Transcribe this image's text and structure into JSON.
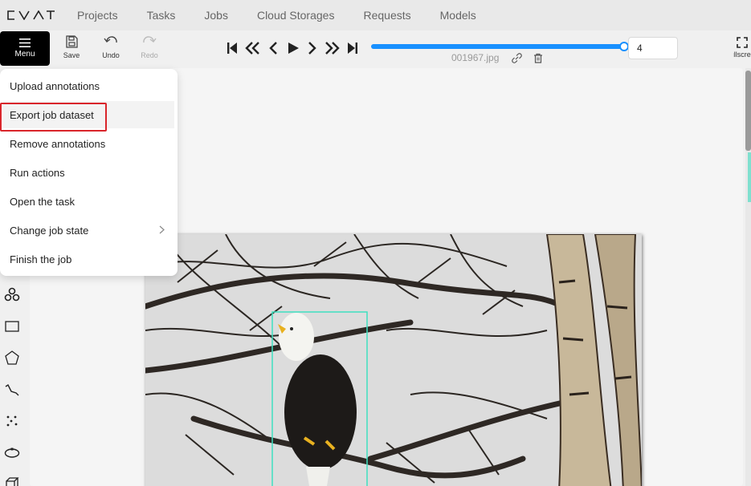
{
  "app": {
    "logo_text": "CVAT"
  },
  "nav": {
    "items": [
      "Projects",
      "Tasks",
      "Jobs",
      "Cloud Storages",
      "Requests",
      "Models"
    ]
  },
  "toolbar": {
    "menu_label": "Menu",
    "save_label": "Save",
    "undo_label": "Undo",
    "redo_label": "Redo",
    "frame_value": "4",
    "filename": "001967.jpg",
    "fullscreen_label": "Fullscreen"
  },
  "menu": {
    "items": [
      "Upload annotations",
      "Export job dataset",
      "Remove annotations",
      "Run actions",
      "Open the task",
      "Change job state",
      "Finish the job"
    ],
    "highlighted": "Export job dataset"
  },
  "colors": {
    "accent": "#1890ff",
    "highlight_border": "#d9252b",
    "annotation_box": "#3ee0c0"
  },
  "icons": {
    "sidebar": [
      "cursor-icon",
      "move-icon",
      "rotate-icon",
      "zoom-icon",
      "fit-icon",
      "ai-tools-icon",
      "rectangle-icon",
      "polygon-icon",
      "polyline-icon",
      "points-icon",
      "ellipse-icon",
      "cuboid-icon"
    ]
  }
}
